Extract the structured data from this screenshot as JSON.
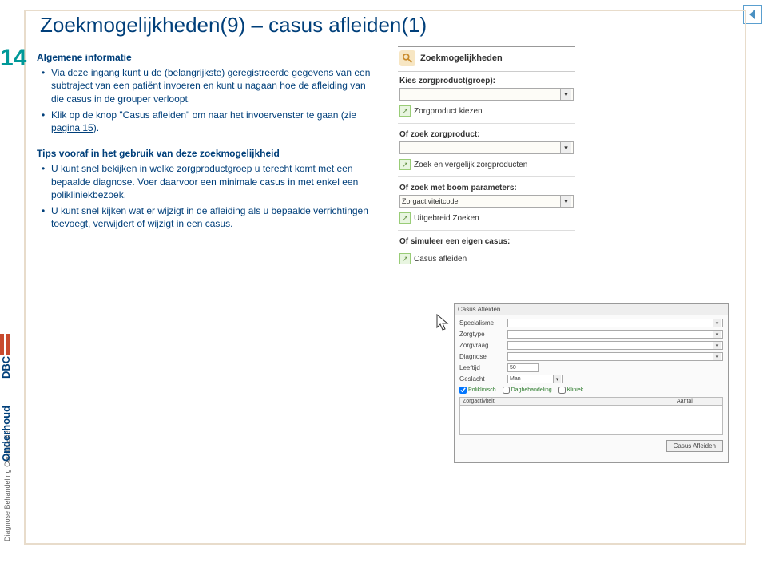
{
  "page_number": "14",
  "title": "Zoekmogelijkheden(9) – casus afleiden(1)",
  "section1_heading": "Algemene informatie",
  "section1_bullets": [
    "Via deze ingang kunt u de (belangrijkste) geregistreerde gegevens van een subtraject van een patiënt invoeren en kunt u nagaan hoe de afleiding van die casus in de grouper verloopt.",
    "Klik op de knop \"Casus afleiden\" om naar het invoervenster te gaan (zie "
  ],
  "section1_link": "pagina 15",
  "section1_link_suffix": ").",
  "section2_heading": "Tips vooraf in het gebruik van deze zoekmogelijkheid",
  "section2_bullets": [
    "U kunt snel bekijken in welke zorgproductgroep u terecht komt met een bepaalde diagnose. Voer daarvoor een minimale casus in met enkel een polikliniekbezoek.",
    "U kunt snel kijken wat er wijzigt in de afleiding als u bepaalde verrichtingen toevoegt, verwijdert of wijzigt in een casus."
  ],
  "right_panel": {
    "title": "Zoekmogelijkheden",
    "label_group": "Kies zorgproduct(groep):",
    "link_choose": "Zorgproduct kiezen",
    "label_search": "Of zoek zorgproduct:",
    "link_compare": "Zoek en vergelijk zorgproducten",
    "label_tree": "Of zoek met boom parameters:",
    "tree_value": "Zorgactiviteitcode",
    "link_extended": "Uitgebreid Zoeken",
    "label_simulate": "Of simuleer een eigen casus:",
    "link_derive": "Casus afleiden"
  },
  "form": {
    "title": "Casus Afleiden",
    "rows": {
      "specialisme": "Specialisme",
      "zorgtype": "Zorgtype",
      "zorgvraag": "Zorgvraag",
      "diagnose": "Diagnose",
      "leeftijd": "Leeftijd",
      "leeftijd_val": "50",
      "geslacht": "Geslacht",
      "geslacht_val": "Man"
    },
    "checks": {
      "poli": "Poliklinisch",
      "dag": "Dagbehandeling",
      "kliniek": "Kliniek"
    },
    "table_h1": "Zorgactiviteit",
    "table_h2": "Aantal",
    "button": "Casus Afleiden"
  }
}
